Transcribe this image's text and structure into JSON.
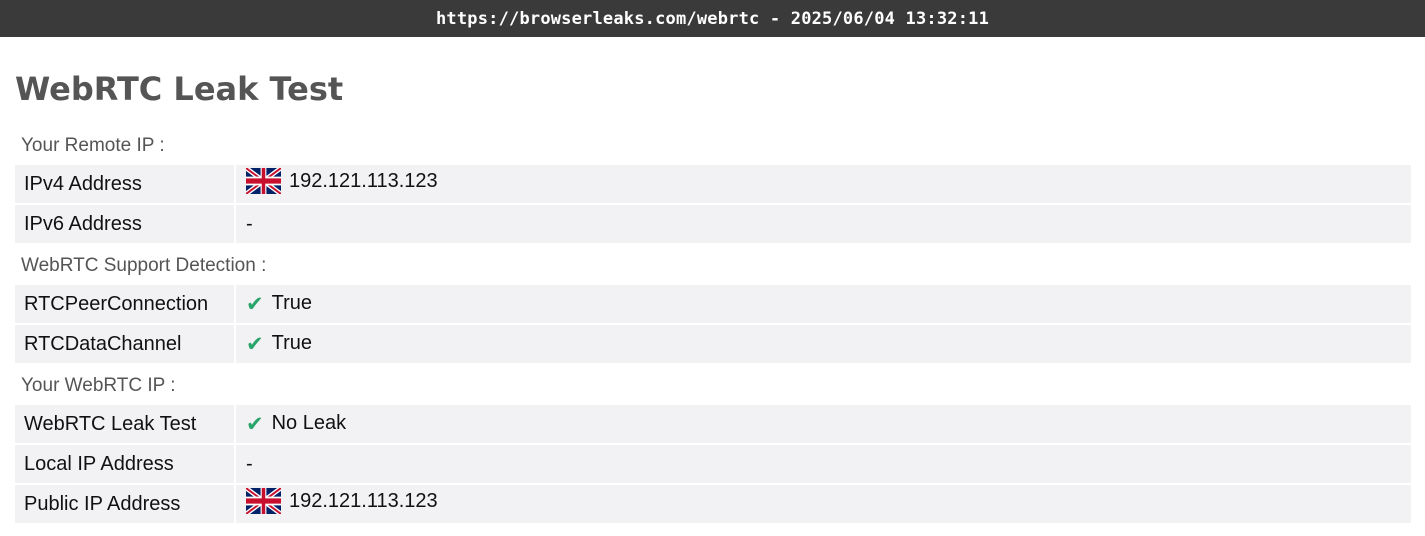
{
  "topbar": {
    "text": "https://browserleaks.com/webrtc - 2025/06/04 13:32:11"
  },
  "page": {
    "title": "WebRTC Leak Test"
  },
  "sections": [
    {
      "label": "Your Remote IP :",
      "rows": [
        {
          "key": "IPv4 Address",
          "value": "192.121.113.123",
          "icon": "uk-flag-icon"
        },
        {
          "key": "IPv6 Address",
          "value": "-"
        }
      ]
    },
    {
      "label": "WebRTC Support Detection :",
      "rows": [
        {
          "key": "RTCPeerConnection",
          "value": "True",
          "icon": "check-icon"
        },
        {
          "key": "RTCDataChannel",
          "value": "True",
          "icon": "check-icon"
        }
      ]
    },
    {
      "label": "Your WebRTC IP :",
      "rows": [
        {
          "key": "WebRTC Leak Test",
          "value": "No Leak",
          "icon": "check-icon"
        },
        {
          "key": "Local IP Address",
          "value": "-"
        },
        {
          "key": "Public IP Address",
          "value": "192.121.113.123",
          "icon": "uk-flag-icon"
        }
      ]
    }
  ],
  "colors": {
    "check": "#2aa56a",
    "topbar_bg": "#3a3a3a",
    "row_bg": "#f2f2f5"
  }
}
